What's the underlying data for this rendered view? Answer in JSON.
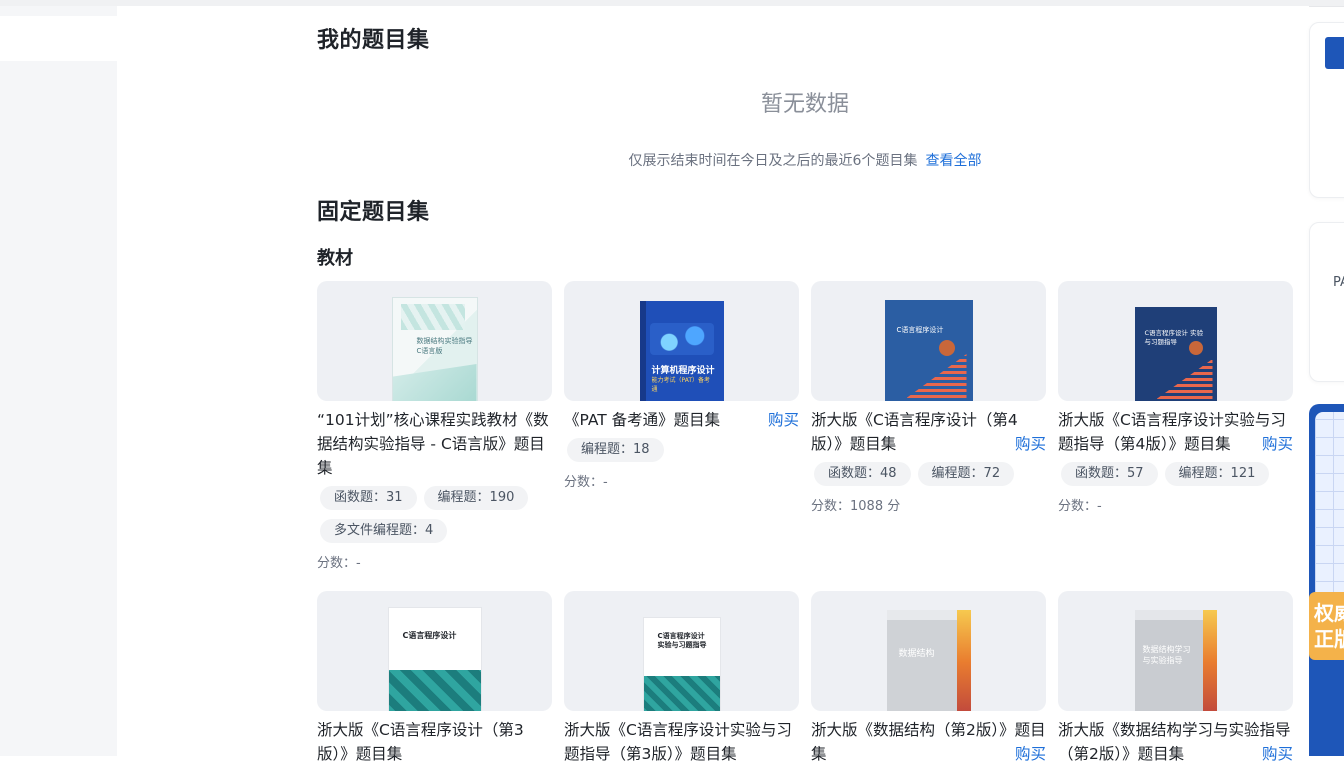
{
  "my_sets": {
    "title": "我的题目集",
    "empty_text": "暂无数据",
    "hint": "仅展示结束时间在今日及之后的最近6个题目集",
    "view_all": "查看全部"
  },
  "fixed_sets": {
    "title": "固定题目集",
    "category": "教材",
    "cards": [
      {
        "title": "“101计划”核心课程实践教材《数据结构实验指导 - C语言版》题目集",
        "buy": "",
        "tags": [
          "函数题：31",
          "编程题：190",
          "多文件编程题：4"
        ],
        "score": "分数：-",
        "cover_text": "数据结构实验指导 C语言版"
      },
      {
        "title": "《PAT 备考通》题目集",
        "buy": "购买",
        "tags": [
          "编程题：18"
        ],
        "score": "分数：-",
        "cover_text": "计算机程序设计",
        "cover_sub": "能力考试（PAT）备考通"
      },
      {
        "title": "浙大版《C语言程序设计（第4版）》题目集",
        "buy": "购买",
        "tags": [
          "函数题：48",
          "编程题：72"
        ],
        "score": "分数：1088 分",
        "cover_text": "C语言程序设计"
      },
      {
        "title": "浙大版《C语言程序设计实验与习题指导（第4版）》题目集",
        "buy": "购买",
        "tags": [
          "函数题：57",
          "编程题：121"
        ],
        "score": "分数：-",
        "cover_text": "C语言程序设计 实验与习题指导"
      },
      {
        "title": "浙大版《C语言程序设计（第3版）》题目集",
        "buy": "",
        "cover_text": "C语言程序设计"
      },
      {
        "title": "浙大版《C语言程序设计实验与习题指导（第3版）》题目集",
        "buy": "",
        "cover_text": "C语言程序设计 实验与习题指导"
      },
      {
        "title": "浙大版《数据结构（第2版）》题目集",
        "buy": "购买",
        "cover_text": "数据结构"
      },
      {
        "title": "浙大版《数据结构学习与实验指导（第2版）》题目集",
        "buy": "购买",
        "cover_text": "数据结构学习 与实验指导"
      }
    ]
  },
  "right_panel": {
    "label": "PA",
    "ad_badge": "权威 正版"
  },
  "colors": {
    "link": "#1e6fd9",
    "brand": "#1e56b8",
    "badge": "#f4b24a"
  }
}
